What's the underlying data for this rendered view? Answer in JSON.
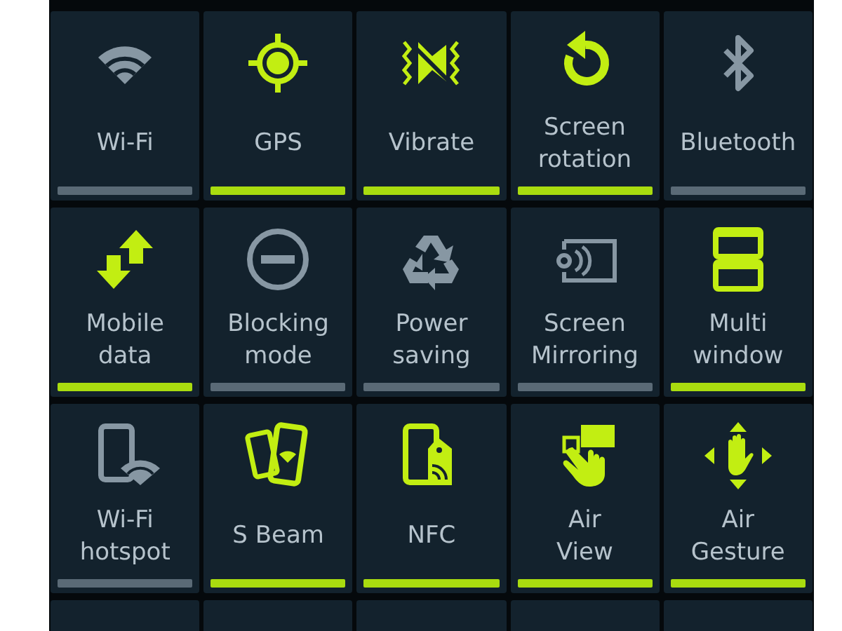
{
  "tiles": [
    {
      "label": "Wi-Fi",
      "on": false
    },
    {
      "label": "GPS",
      "on": true
    },
    {
      "label": "Vibrate",
      "on": true
    },
    {
      "label": "Screen\nrotation",
      "on": true
    },
    {
      "label": "Bluetooth",
      "on": false
    },
    {
      "label": "Mobile\ndata",
      "on": true
    },
    {
      "label": "Blocking\nmode",
      "on": false
    },
    {
      "label": "Power\nsaving",
      "on": false
    },
    {
      "label": "Screen\nMirroring",
      "on": false
    },
    {
      "label": "Multi\nwindow",
      "on": true
    },
    {
      "label": "Wi-Fi\nhotspot",
      "on": false
    },
    {
      "label": "S Beam",
      "on": true
    },
    {
      "label": "NFC",
      "on": true
    },
    {
      "label": "Air\nView",
      "on": true
    },
    {
      "label": "Air\nGesture",
      "on": true
    }
  ]
}
